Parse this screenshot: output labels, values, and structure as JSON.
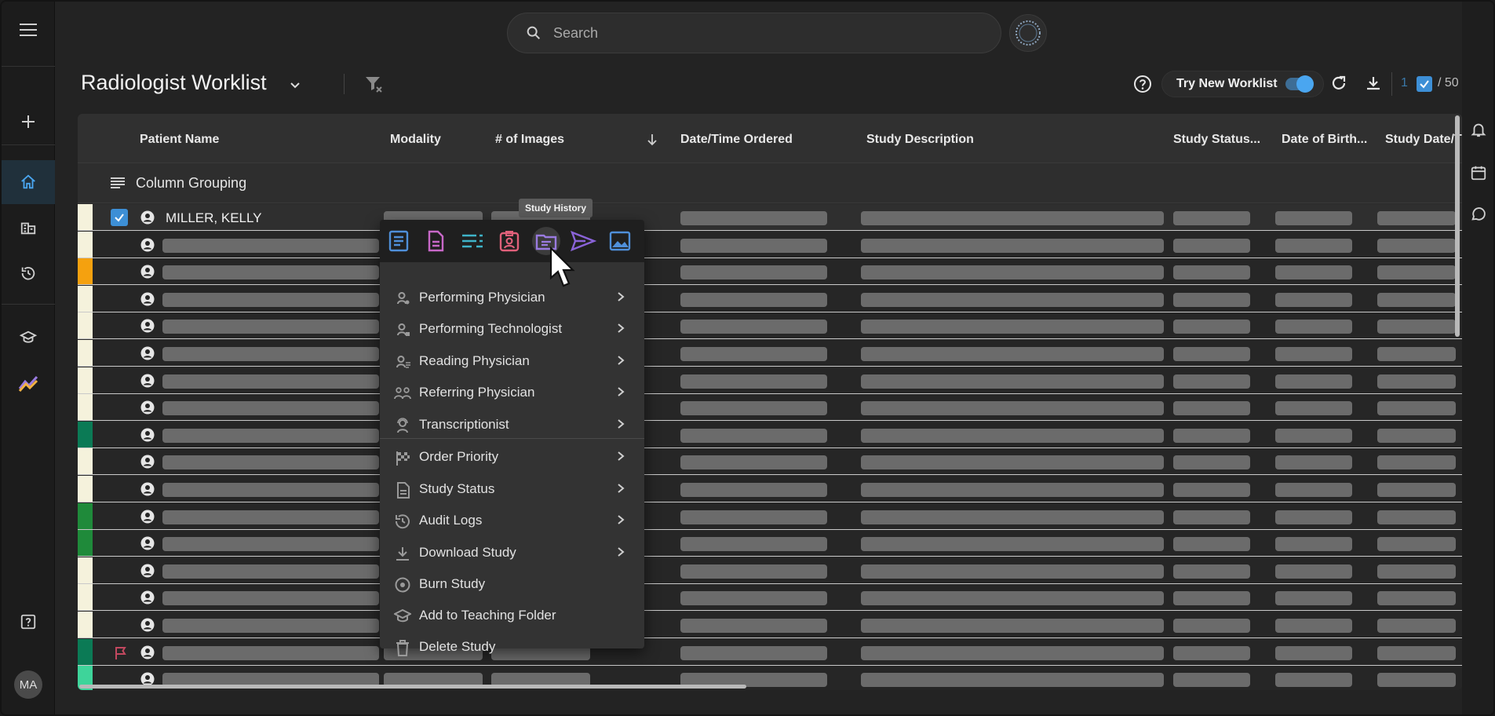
{
  "search": {
    "placeholder": "Search"
  },
  "header": {
    "title": "Radiologist Worklist",
    "try_new_label": "Try New Worklist",
    "selected_count": "1",
    "total_count": "/ 50"
  },
  "left_rail": {
    "avatar_initials": "MA"
  },
  "grid": {
    "columns": [
      "Patient Name",
      "Modality",
      "# of Images",
      "Date/Time Ordered",
      "Study Description",
      "Study Status...",
      "Date of Birth...",
      "Study Date/T"
    ],
    "grouping_label": "Column Grouping",
    "first_patient": "MILLER, KELLY",
    "row_status_colors": [
      "#f5f2dc",
      "#f5f2dc",
      "#f5a10f",
      "#f5f2dc",
      "#f5f2dc",
      "#f5f2dc",
      "#f5f2dc",
      "#f5f2dc",
      "#0b7a55",
      "#f5f2dc",
      "#f5f2dc",
      "#1f8a3a",
      "#1f8a3a",
      "#f5f2dc",
      "#f5f2dc",
      "#f5f2dc",
      "#0b7a55",
      "#3ed49a"
    ]
  },
  "context_menu": {
    "tooltip": "Study History",
    "toolbar_icons": [
      "report-icon",
      "document-icon",
      "list-icon",
      "patient-card-icon",
      "study-history-icon",
      "send-icon",
      "image-icon"
    ],
    "items": [
      {
        "label": "Performing Physician",
        "icon": "physician-icon",
        "submenu": true
      },
      {
        "label": "Performing Technologist",
        "icon": "technologist-icon",
        "submenu": true
      },
      {
        "label": "Reading Physician",
        "icon": "reading-physician-icon",
        "submenu": true
      },
      {
        "label": "Referring Physician",
        "icon": "referring-physician-icon",
        "submenu": true
      },
      {
        "label": "Transcriptionist",
        "icon": "transcriptionist-icon",
        "submenu": true
      },
      {
        "label": "Order Priority",
        "icon": "flag-checkered-icon",
        "submenu": true
      },
      {
        "label": "Study Status",
        "icon": "document-icon",
        "submenu": true
      },
      {
        "label": "Audit Logs",
        "icon": "history-icon",
        "submenu": true
      },
      {
        "label": "Download Study",
        "icon": "download-icon",
        "submenu": true
      },
      {
        "label": "Burn Study",
        "icon": "disc-icon",
        "submenu": false
      },
      {
        "label": "Add to Teaching Folder",
        "icon": "graduation-cap-icon",
        "submenu": false
      },
      {
        "label": "Delete Study",
        "icon": "trash-icon",
        "submenu": false
      }
    ]
  },
  "colors": {
    "accent": "#3d8fd6",
    "toolbar_blue": "#4f8fd9",
    "toolbar_pink": "#c868c8",
    "toolbar_teal": "#3fb3c8",
    "toolbar_red": "#e0607a",
    "toolbar_purple": "#9a7be0"
  }
}
